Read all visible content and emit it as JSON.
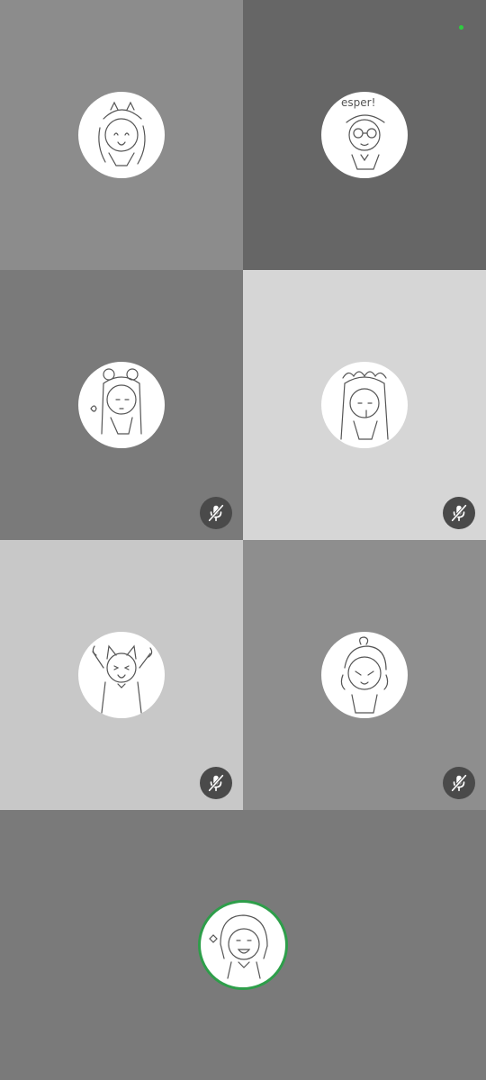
{
  "call": {
    "participants": [
      {
        "id": "p1",
        "tile_color": "#8c8c8c",
        "muted": false,
        "avatar_icon": "sketch-girl-headband-avatar"
      },
      {
        "id": "p2",
        "tile_color": "#666666",
        "muted": false,
        "avatar_icon": "sketch-boy-glasses-avatar",
        "avatar_text": "esper!",
        "status": "online"
      },
      {
        "id": "p3",
        "tile_color": "#7a7a7a",
        "muted": true,
        "avatar_icon": "sketch-girl-buns-avatar"
      },
      {
        "id": "p4",
        "tile_color": "#d6d6d6",
        "muted": true,
        "avatar_icon": "sketch-maid-girl-avatar"
      },
      {
        "id": "p5",
        "tile_color": "#c8c8c8",
        "muted": true,
        "avatar_icon": "sketch-cat-ears-avatar"
      },
      {
        "id": "p6",
        "tile_color": "#8e8e8e",
        "muted": true,
        "avatar_icon": "sketch-boy-ahoge-avatar"
      }
    ],
    "self": {
      "tile_color": "#7a7a7a",
      "ring_color": "#2e9e4a",
      "speaking": true,
      "avatar_icon": "sketch-self-short-hair-avatar"
    },
    "colors": {
      "mute_badge": "#4a4a4a",
      "online_dot": "#2ecc40"
    }
  }
}
